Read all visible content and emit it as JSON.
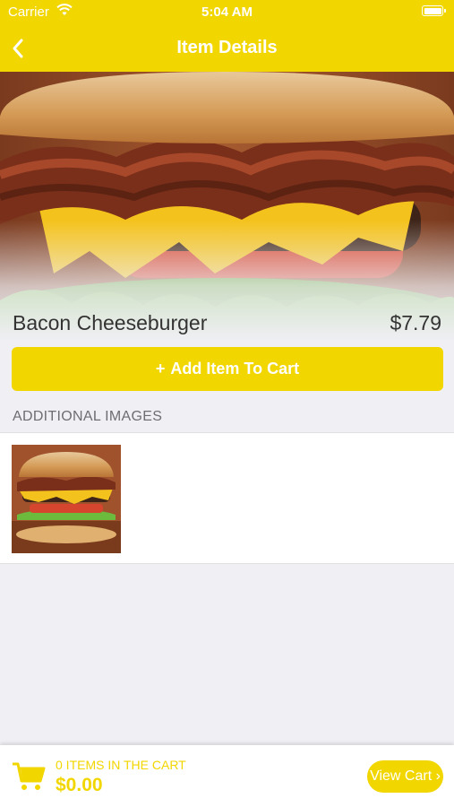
{
  "status_bar": {
    "carrier": "Carrier",
    "time": "5:04 AM"
  },
  "nav": {
    "title": "Item Details",
    "back_icon": "chevron-left-icon"
  },
  "item": {
    "name": "Bacon Cheeseburger",
    "price": "$7.79"
  },
  "add_button": {
    "icon": "+",
    "label": "Add Item To Cart"
  },
  "additional_images": {
    "header": "ADDITIONAL IMAGES"
  },
  "cart": {
    "items_text": "0 ITEMS IN THE CART",
    "total": "$0.00",
    "view_label": "View Cart ›"
  },
  "colors": {
    "accent": "#f2d600",
    "background": "#efeff4",
    "text": "#333333"
  }
}
